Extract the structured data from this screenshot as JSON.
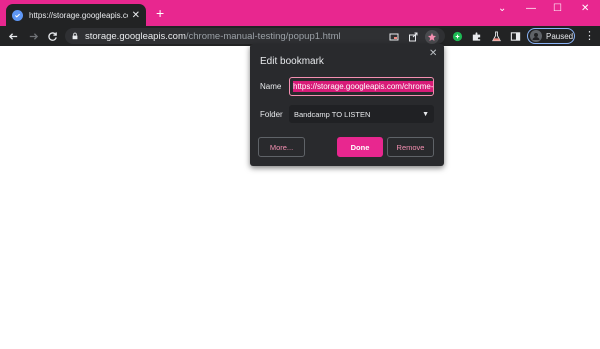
{
  "tab": {
    "title": "https://storage.googleapis.com/c",
    "close": "✕"
  },
  "new_tab": "+",
  "window_controls": {
    "dropdown": "⌄",
    "minimize": "—",
    "maximize": "☐",
    "close": "✕"
  },
  "address_bar": {
    "host": "storage.googleapis.com",
    "path": "/chrome-manual-testing/popup1.html"
  },
  "profile": {
    "status": "Paused"
  },
  "menu": "⋮",
  "bookmark_dialog": {
    "title": "Edit bookmark",
    "close": "✕",
    "name_label": "Name",
    "name_value": "https://storage.googleapis.com/chrome-m",
    "folder_label": "Folder",
    "folder_value": "Bandcamp TO LISTEN",
    "folder_caret": "▼",
    "more_button": "More...",
    "done_button": "Done",
    "remove_button": "Remove"
  },
  "colors": {
    "accent": "#e8278f",
    "chrome_dark": "#222324",
    "dialog_bg": "#292a2d",
    "link_pink": "#f48fb1"
  },
  "icons": [
    "favicon-icon",
    "back-arrow-icon",
    "forward-arrow-icon",
    "reload-icon",
    "lock-icon",
    "cast-icon",
    "share-icon",
    "star-icon",
    "extension-g-icon",
    "puzzle-icon",
    "flask-icon",
    "sidepanel-icon",
    "avatar-icon"
  ]
}
